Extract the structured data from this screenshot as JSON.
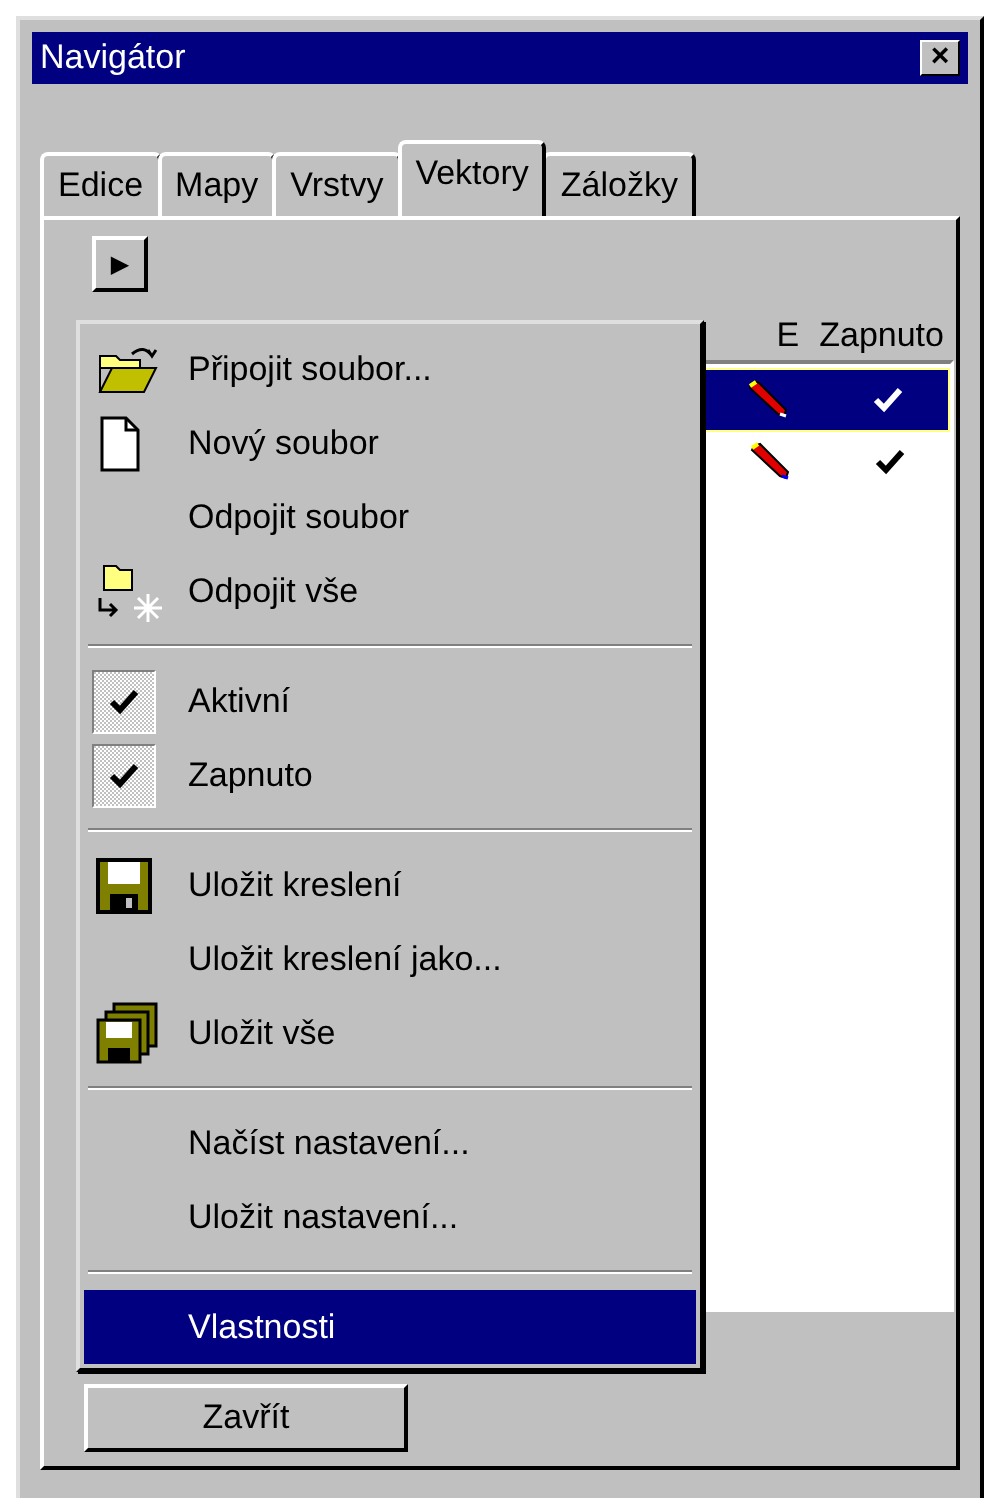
{
  "window": {
    "title": "Navigátor",
    "close_glyph": "×"
  },
  "tabs": [
    {
      "label": "Edice",
      "selected": false
    },
    {
      "label": "Mapy",
      "selected": false
    },
    {
      "label": "Vrstvy",
      "selected": false
    },
    {
      "label": "Vektory",
      "selected": true
    },
    {
      "label": "Záložky",
      "selected": false
    }
  ],
  "toolbar": {
    "play_glyph": "▶"
  },
  "table": {
    "columns": [
      "E",
      "Zapnuto"
    ],
    "rows": [
      {
        "selected": true,
        "editable": true,
        "on": true
      },
      {
        "selected": false,
        "editable": true,
        "on": true
      }
    ]
  },
  "menu": [
    {
      "kind": "open-file",
      "label": "Připojit soubor...",
      "selected": false
    },
    {
      "kind": "new-file",
      "label": "Nový soubor",
      "selected": false
    },
    {
      "kind": "plain",
      "label": "Odpojit soubor",
      "selected": false
    },
    {
      "kind": "detach-all",
      "label": "Odpojit vše",
      "selected": false
    },
    {
      "kind": "separator"
    },
    {
      "kind": "check",
      "label": "Aktivní",
      "checked": true,
      "selected": false
    },
    {
      "kind": "check",
      "label": "Zapnuto",
      "checked": true,
      "selected": false
    },
    {
      "kind": "separator"
    },
    {
      "kind": "save",
      "label": "Uložit kreslení",
      "selected": false
    },
    {
      "kind": "plain",
      "label": "Uložit kreslení jako...",
      "selected": false
    },
    {
      "kind": "save-all",
      "label": "Uložit vše",
      "selected": false
    },
    {
      "kind": "separator"
    },
    {
      "kind": "plain",
      "label": "Načíst nastavení...",
      "selected": false
    },
    {
      "kind": "plain",
      "label": "Uložit nastavení...",
      "selected": false
    },
    {
      "kind": "separator"
    },
    {
      "kind": "plain",
      "label": "Vlastnosti",
      "selected": true
    }
  ],
  "close_button": {
    "label": "Zavřít"
  }
}
